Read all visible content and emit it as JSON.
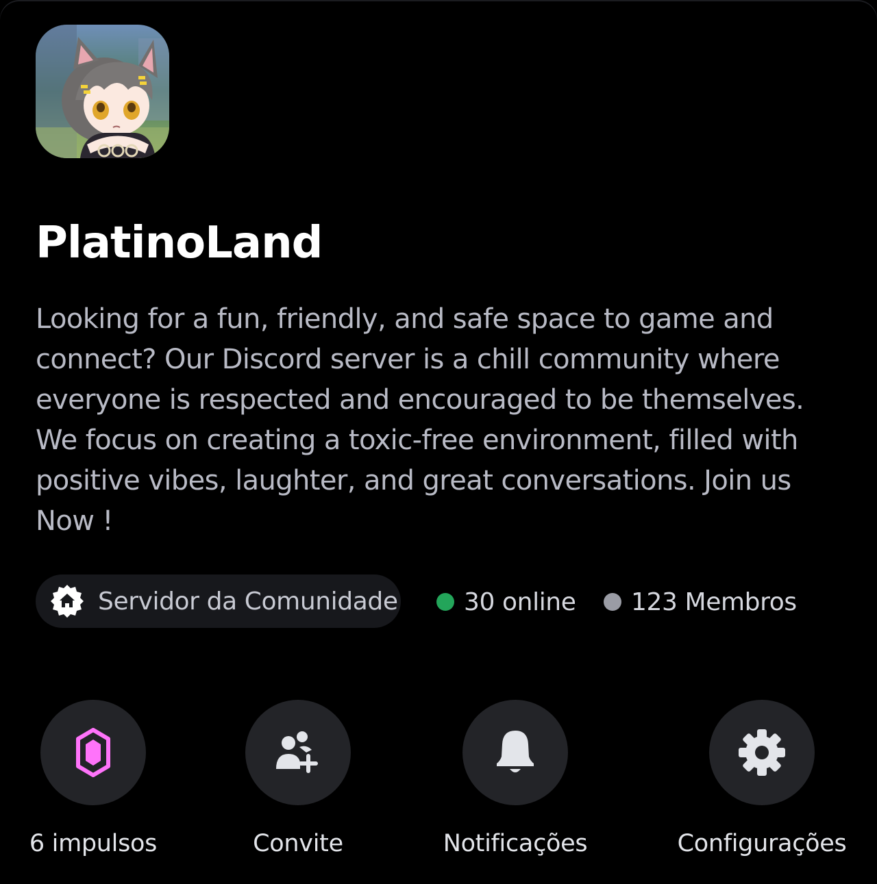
{
  "server": {
    "name": "PlatinoLand",
    "description": "Looking for a fun, friendly, and safe space to game and connect? Our Discord server is a chill community where everyone is respected and encouraged to be themselves. We focus on creating a toxic-free environment, filled with positive vibes, laughter, and great conversations. Join us Now !",
    "icon": "anime-cat-girl-avatar"
  },
  "badge": {
    "label": "Servidor da Comunidade",
    "icon": "community-home-icon"
  },
  "stats": {
    "online_label": "30 online",
    "online_color": "#23a55a",
    "members_label": "123 Membros",
    "members_color": "#9a9ca5"
  },
  "actions": {
    "boosts_label": "6 impulsos",
    "invite_label": "Convite",
    "notifications_label": "Notificações",
    "settings_label": "Configurações"
  },
  "colors": {
    "background": "#000000",
    "description_text": "#b9bbc6",
    "action_circle": "#232428",
    "boost_accent": "#ff73fa"
  }
}
